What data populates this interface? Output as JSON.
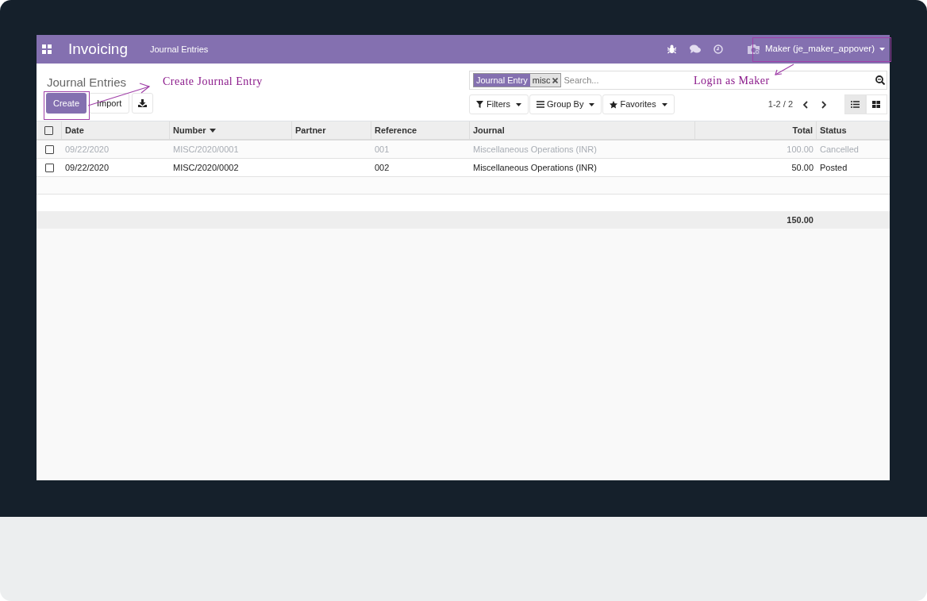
{
  "navbar": {
    "app_title": "Invoicing",
    "menu_items": [
      "Journal Entries"
    ],
    "user": "Maker (je_maker_appover)"
  },
  "control_panel": {
    "breadcrumb": "Journal Entries",
    "buttons": [
      {
        "kind": "primary",
        "label": "Create"
      },
      {
        "kind": "secondary",
        "label": "Import"
      },
      {
        "kind": "download"
      }
    ],
    "search": {
      "facets": [
        {
          "field": "Journal Entry",
          "value": "misc"
        }
      ],
      "placeholder": "Search..."
    },
    "filters": [
      {
        "kind": "filter",
        "label": "Filters"
      },
      {
        "kind": "group",
        "label": "Group By"
      },
      {
        "kind": "favorite",
        "label": "Favorites"
      }
    ],
    "pager": "1-2 / 2",
    "views": [
      {
        "kind": "list",
        "selected": true
      },
      {
        "kind": "kanban",
        "selected": false
      }
    ]
  },
  "table": {
    "select_all_checked": false,
    "columns": [
      {
        "label": "Date",
        "kind": "text",
        "sorted": false
      },
      {
        "label": "Number",
        "kind": "text",
        "sorted": true
      },
      {
        "label": "Partner",
        "kind": "text",
        "sorted": false
      },
      {
        "label": "Reference",
        "kind": "text",
        "sorted": false
      },
      {
        "label": "Journal",
        "kind": "text",
        "sorted": false
      },
      {
        "label": "Total",
        "kind": "amount",
        "sorted": false
      },
      {
        "label": "Status",
        "kind": "text",
        "sorted": false
      }
    ],
    "rows": [
      {
        "muted": true,
        "checked": false,
        "cells": [
          "09/22/2020",
          "MISC/2020/0001",
          "",
          "001",
          "Miscellaneous Operations (INR)",
          "100.00",
          "Cancelled"
        ]
      },
      {
        "muted": false,
        "checked": false,
        "cells": [
          "09/22/2020",
          "MISC/2020/0002",
          "",
          "002",
          "Miscellaneous Operations (INR)",
          "50.00",
          "Posted"
        ]
      }
    ],
    "footer_total": "150.00"
  },
  "annotations": [
    {
      "kind": "create",
      "text": "Create Journal Entry"
    },
    {
      "kind": "login",
      "text": "Login as Maker"
    }
  ]
}
